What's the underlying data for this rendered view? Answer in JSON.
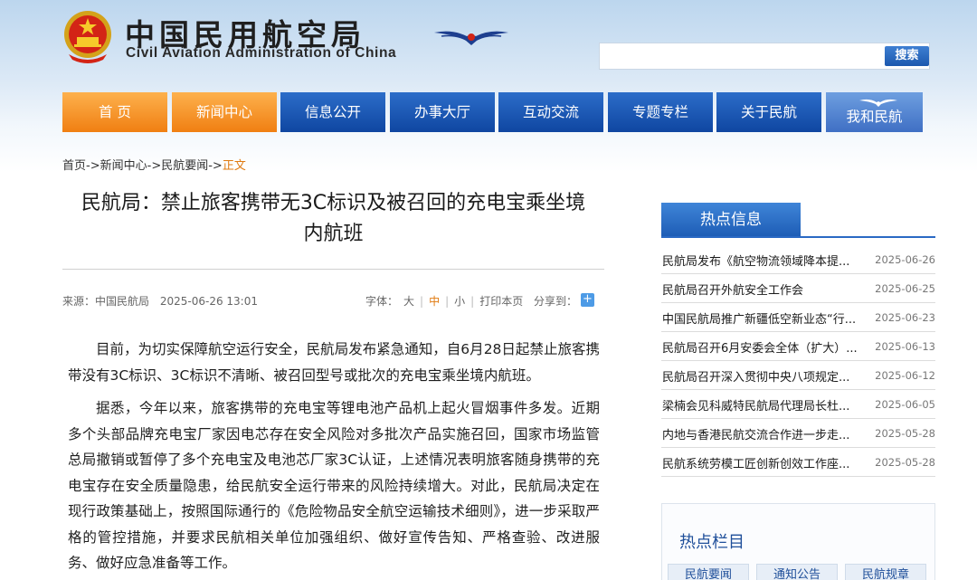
{
  "header": {
    "logo_cn": "中国民用航空局",
    "logo_en": "Civil Aviation Administration of China",
    "emblem_icon": "national-emblem-icon",
    "wings_icon": "caac-wings-logo-icon",
    "search_placeholder": "",
    "search_button": "搜索"
  },
  "nav": {
    "items": [
      {
        "label": "首 页",
        "color": "#f3901f"
      },
      {
        "label": "新闻中心",
        "color": "#f3901f"
      },
      {
        "label": "信息公开",
        "color": "#1a52ad"
      },
      {
        "label": "办事大厅",
        "color": "#1a52ad"
      },
      {
        "label": "互动交流",
        "color": "#1a52ad"
      },
      {
        "label": "专题专栏",
        "color": "#1a52ad"
      },
      {
        "label": "关于民航",
        "color": "#1a52ad"
      },
      {
        "label": "我和民航",
        "color": "#4d80d0"
      }
    ]
  },
  "breadcrumb": {
    "items": [
      "首页",
      "->",
      "新闻中心",
      "->",
      "民航要闻",
      "->"
    ],
    "current": "正文"
  },
  "article": {
    "title_line1": "民航局：禁止旅客携带无3C标识及被召回的充电宝乘坐境",
    "title_line2": "内航班",
    "source": "来源：中国民航局",
    "datetime": "2025-06-26 13:01",
    "font_label": "字体：",
    "font_large": "大",
    "font_medium": "中",
    "font_small": "小",
    "separator": "|",
    "print": "打印本页",
    "share_label": "分享到：",
    "share_icon_glyph": "+",
    "paragraphs": [
      "目前，为切实保障航空运行安全，民航局发布紧急通知，自6月28日起禁止旅客携带没有3C标识、3C标识不清晰、被召回型号或批次的充电宝乘坐境内航班。",
      "据悉，今年以来，旅客携带的充电宝等锂电池产品机上起火冒烟事件多发。近期多个头部品牌充电宝厂家因电芯存在安全风险对多批次产品实施召回，国家市场监管总局撤销或暂停了多个充电宝及电池芯厂家3C认证，上述情况表明旅客随身携带的充电宝存在安全质量隐患，给民航安全运行带来的风险持续增大。对此，民航局决定在现行政策基础上，按照国际通行的《危险物品安全航空运输技术细则》，进一步采取严格的管控措施，并要求民航相关单位加强组织、做好宣传告知、严格查验、改进服务、做好应急准备等工作。"
    ]
  },
  "sidebar": {
    "hot_title": "热点信息",
    "hot_items": [
      {
        "title": "民航局发布《航空物流领域降本提...",
        "date": "2025-06-26"
      },
      {
        "title": "民航局召开外航安全工作会",
        "date": "2025-06-25"
      },
      {
        "title": "中国民航局推广新疆低空新业态“行...",
        "date": "2025-06-23"
      },
      {
        "title": "民航局召开6月安委会全体（扩大）...",
        "date": "2025-06-13"
      },
      {
        "title": "民航局召开深入贯彻中央八项规定...",
        "date": "2025-06-12"
      },
      {
        "title": "梁楠会见科威特民航局代理局长杜...",
        "date": "2025-06-05"
      },
      {
        "title": "内地与香港民航交流合作进一步走...",
        "date": "2025-05-28"
      },
      {
        "title": "民航系统劳模工匠创新创效工作座...",
        "date": "2025-05-28"
      }
    ],
    "columns_title": "热点栏目",
    "column_tabs": [
      "民航要闻",
      "通知公告",
      "民航规章"
    ]
  }
}
